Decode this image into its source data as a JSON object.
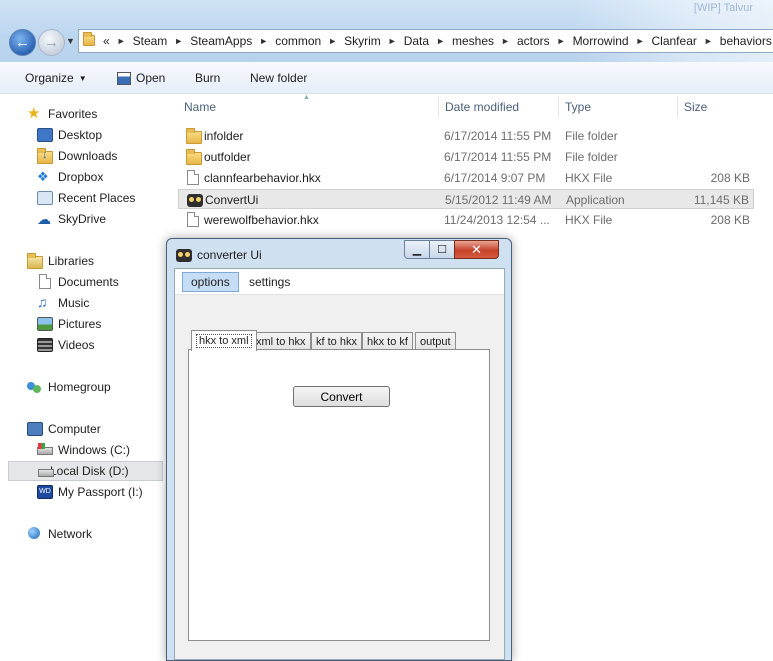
{
  "explorer": {
    "ghost_text": "[WIP] Talvur",
    "breadcrumb": [
      "«",
      "Steam",
      "SteamApps",
      "common",
      "Skyrim",
      "Data",
      "meshes",
      "actors",
      "Morrowind",
      "Clanfear",
      "behaviors"
    ],
    "toolbar": {
      "organize": "Organize",
      "open": "Open",
      "burn": "Burn",
      "new_folder": "New folder"
    },
    "nav": {
      "favorites": "Favorites",
      "desktop": "Desktop",
      "downloads": "Downloads",
      "dropbox": "Dropbox",
      "recent_places": "Recent Places",
      "skydrive": "SkyDrive",
      "libraries": "Libraries",
      "documents": "Documents",
      "music": "Music",
      "pictures": "Pictures",
      "videos": "Videos",
      "homegroup": "Homegroup",
      "computer": "Computer",
      "windows_c": "Windows (C:)",
      "local_disk_d": "Local Disk (D:)",
      "my_passport": "My Passport (I:)",
      "network": "Network"
    },
    "columns": {
      "name": "Name",
      "date": "Date modified",
      "type": "Type",
      "size": "Size"
    },
    "files": [
      {
        "name": "infolder",
        "date": "6/17/2014 11:55 PM",
        "type": "File folder",
        "size": "",
        "icon": "folder-icon"
      },
      {
        "name": "outfolder",
        "date": "6/17/2014 11:55 PM",
        "type": "File folder",
        "size": "",
        "icon": "folder-icon"
      },
      {
        "name": "clannfearbehavior.hkx",
        "date": "6/17/2014 9:07 PM",
        "type": "HKX File",
        "size": "208 KB",
        "icon": "document-icon"
      },
      {
        "name": "ConvertUi",
        "date": "5/15/2012 11:49 AM",
        "type": "Application",
        "size": "11,145 KB",
        "icon": "application-icon"
      },
      {
        "name": "werewolfbehavior.hkx",
        "date": "11/24/2013 12:54 ...",
        "type": "HKX File",
        "size": "208 KB",
        "icon": "document-icon"
      }
    ]
  },
  "dialog": {
    "title": "converter Ui",
    "min_glyph": "▁",
    "max_glyph": "☐",
    "close_glyph": "✕",
    "menu": {
      "options": "options",
      "settings": "settings"
    },
    "tabs": [
      "hkx to xml",
      "xml to hkx",
      "kf to hkx",
      "hkx to kf",
      "output"
    ],
    "convert_label": "Convert"
  },
  "colors": {
    "title_bar": "#bcd6ef",
    "selection": "#e8e8e8",
    "dialog_frame": "#cfe0f1",
    "close_button": "#c7432c",
    "menu_active": "#c6def5"
  }
}
